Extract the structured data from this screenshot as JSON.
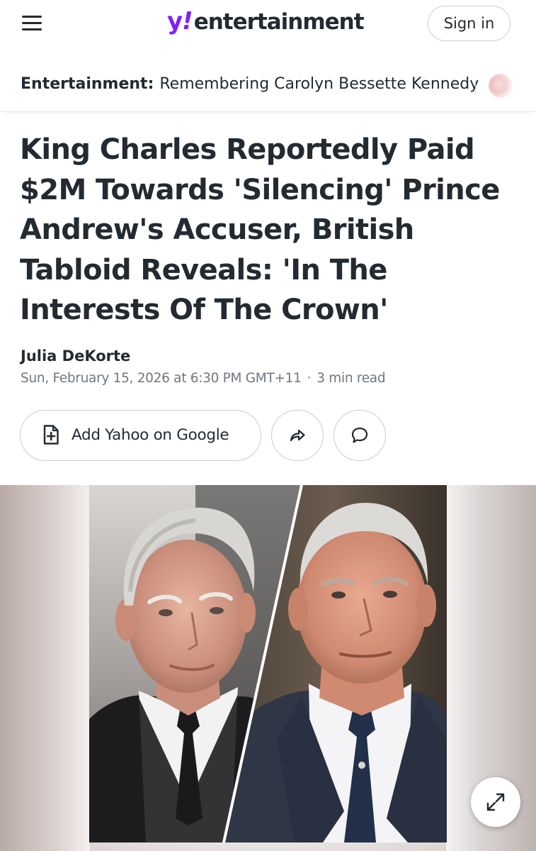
{
  "header": {
    "logo_y": "y",
    "logo_bang": "!",
    "logo_word": "entertainment",
    "signin_label": "Sign in"
  },
  "subnav": {
    "section_label": "Entertainment:",
    "link_label": "Remembering Carolyn Bessette Kennedy"
  },
  "article": {
    "headline": "King Charles Reportedly Paid $2M Towards 'Silencing' Prince Andrew's Accuser, British Tabloid Reveals: 'In The Interests Of The Crown'",
    "author": "Julia DeKorte",
    "date": "Sun, February 15, 2026 at 6:30 PM GMT+11",
    "read_time": "3 min read"
  },
  "actions": {
    "add_google_label": "Add Yahoo on Google"
  },
  "colors": {
    "brand_purple": "#7e1fff",
    "text_primary": "#232a31",
    "text_secondary": "#6e7780",
    "border": "#c9ccd1"
  },
  "icons": {
    "menu": "hamburger-icon",
    "add_google": "add-document-icon",
    "share": "share-arrow-icon",
    "comment": "speech-bubble-icon",
    "expand": "expand-icon"
  }
}
